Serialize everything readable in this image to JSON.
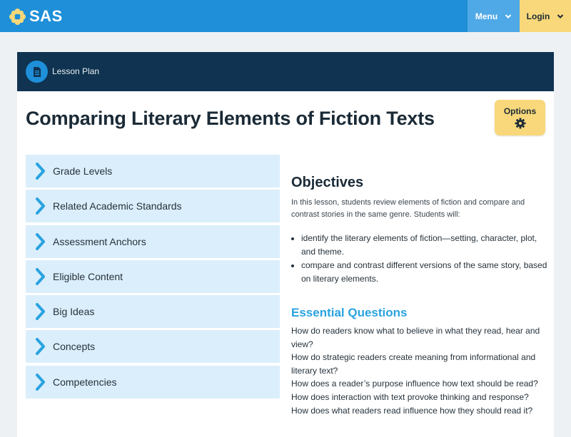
{
  "header": {
    "brand": "SAS",
    "menu_label": "Menu",
    "login_label": "Login",
    "accent_color": "#1e8fd8"
  },
  "card": {
    "type_label": "Lesson Plan",
    "title": "Comparing Literary Elements of Fiction Texts",
    "options_label": "Options",
    "header_color": "#0f3350"
  },
  "sidebar": {
    "items": [
      {
        "label": "Grade Levels"
      },
      {
        "label": "Related Academic Standards"
      },
      {
        "label": "Assessment Anchors"
      },
      {
        "label": "Eligible Content"
      },
      {
        "label": "Big Ideas"
      },
      {
        "label": "Concepts"
      },
      {
        "label": "Competencies"
      }
    ]
  },
  "objectives": {
    "title": "Objectives",
    "intro": "In this lesson, students review elements of fiction and compare and contrast stories in the same genre. Students will:",
    "items": [
      "identify the literary elements of fiction—setting, character, plot, and theme.",
      "compare and contrast different versions of the same story, based on literary elements."
    ]
  },
  "essential_questions": {
    "title": "Essential Questions",
    "items": [
      "How do readers know what to believe in what they read, hear and view?",
      "How do strategic readers create meaning from informational and literary text?",
      "How does a reader’s purpose influence how text should be read?",
      "How does interaction with text provoke thinking and response?",
      "How does what readers read influence how they should read it?"
    ]
  },
  "icons": {
    "logo": "flower-logo-icon",
    "menu_chevron": "chevron-down-icon",
    "login_chevron": "chevron-down-icon",
    "lesson_plan": "document-icon",
    "options": "gear-icon",
    "accordion": "chevron-right-icon"
  }
}
